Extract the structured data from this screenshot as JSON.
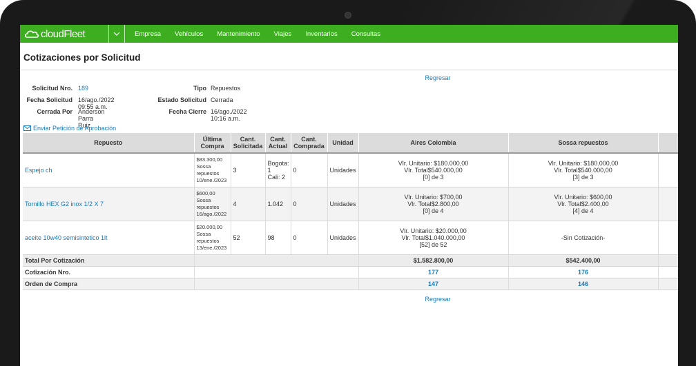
{
  "nav": {
    "logo_text": "cloudFleet",
    "items": [
      "Empresa",
      "Vehículos",
      "Mantenimiento",
      "Viajes",
      "Inventarios",
      "Consultas"
    ]
  },
  "page": {
    "title": "Cotizaciones por Solicitud",
    "regresar": "Regresar"
  },
  "info": {
    "solicitud_label": "Solicitud Nro.",
    "solicitud_value": "189",
    "tipo_label": "Tipo",
    "tipo_value": "Repuestos",
    "fecha_label": "Fecha Solicitud",
    "fecha_value": "16/ago./2022 09:55 a.m.",
    "estado_label": "Estado Solicitud",
    "estado_value": "Cerrada",
    "cerrada_label": "Cerrada Por",
    "cerrada_value": "Anderson Parra Ruiz",
    "cierre_label": "Fecha Cierre",
    "cierre_value": "16/ago./2022 10:16 a.m."
  },
  "approval_link": "Enviar Petición de Aprobación",
  "table": {
    "headers": {
      "repuesto": "Repuesto",
      "ultima": "Última Compra",
      "solicitada": "Cant. Solicitada",
      "actual": "Cant. Actual",
      "comprada": "Cant. Comprada",
      "unidad": "Unidad",
      "prov1": "Aires Colombia",
      "prov2": "Sossa repuestos"
    },
    "rows": [
      {
        "repuesto": "Espejo ch",
        "ultima": [
          "$83.300,00",
          "Sossa",
          "repuestos",
          "10/ene./2023"
        ],
        "solicitada": "3",
        "actual": [
          "Bogota:",
          "1",
          "Cali: 2"
        ],
        "comprada": "0",
        "unidad": "Unidades",
        "prov1": [
          "Vlr. Unitario: $180.000,00",
          "Vlr. Total$540.000,00",
          "[0] de 3"
        ],
        "prov2": [
          "Vlr. Unitario: $180.000,00",
          "Vlr. Total$540.000,00",
          "[3] de 3"
        ]
      },
      {
        "repuesto": "Tornillo HEX G2 inox 1/2 X 7",
        "ultima": [
          "$600,00",
          "Sossa",
          "repuestos",
          "16/ago./2022"
        ],
        "solicitada": "4",
        "actual": [
          "1.042"
        ],
        "comprada": "0",
        "unidad": "Unidades",
        "prov1": [
          "Vlr. Unitario: $700,00",
          "Vlr. Total$2.800,00",
          "[0] de 4"
        ],
        "prov2": [
          "Vlr. Unitario: $600,00",
          "Vlr. Total$2.400,00",
          "[4] de 4"
        ]
      },
      {
        "repuesto": "aceite 10w40 semisintetico 1lt",
        "ultima": [
          "$20.000,00",
          "Sossa",
          "repuestos",
          "13/ene./2023"
        ],
        "solicitada": "52",
        "actual": [
          "98"
        ],
        "comprada": "0",
        "unidad": "Unidades",
        "prov1": [
          "Vlr. Unitario: $20.000,00",
          "Vlr. Total$1.040.000,00",
          "[52] de 52"
        ],
        "prov2": [
          "-Sin Cotización-"
        ]
      }
    ],
    "footer": {
      "total_label": "Total Por Cotización",
      "total_prov1": "$1.582.800,00",
      "total_prov2": "$542.400,00",
      "cotizacion_label": "Cotización Nro.",
      "cotizacion_prov1": "177",
      "cotizacion_prov2": "176",
      "orden_label": "Orden de Compra",
      "orden_prov1": "147",
      "orden_prov2": "146"
    }
  },
  "colors": {
    "navbar": "#3dae1f",
    "link": "#1a78b8"
  }
}
